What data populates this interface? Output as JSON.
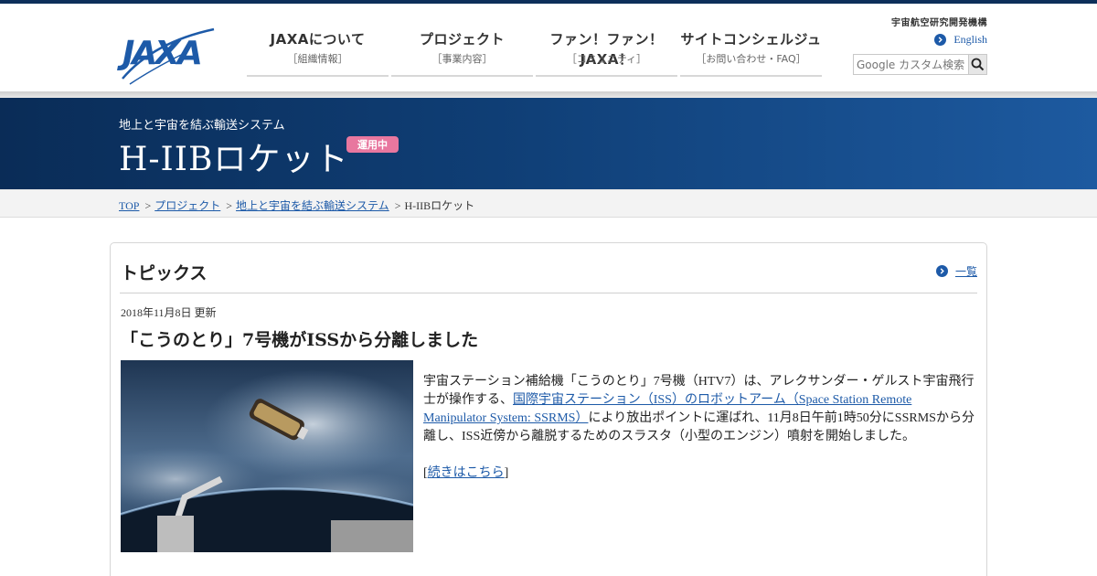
{
  "header": {
    "logo_text": "JAXA",
    "org_name": "宇宙航空研究開発機構",
    "english_label": "English",
    "search_placeholder": "Google カスタム検索",
    "nav": [
      {
        "main": "JAXAについて",
        "sub": "［組織情報］"
      },
      {
        "main": "プロジェクト",
        "sub": "［事業内容］"
      },
      {
        "main": "ファン！ファン！JAXA！",
        "sub": "［コミュニティ］"
      },
      {
        "main": "サイトコンシェルジュ",
        "sub": "［お問い合わせ・FAQ］"
      }
    ]
  },
  "hero": {
    "subtitle": "地上と宇宙を結ぶ輸送システム",
    "title": "H-IIBロケット",
    "badge": "運用中"
  },
  "breadcrumb": {
    "items": [
      "TOP",
      "プロジェクト",
      "地上と宇宙を結ぶ輸送システム"
    ],
    "current": "H-IIBロケット",
    "separator": ">"
  },
  "topics": {
    "title": "トピックス",
    "list_link": "一覧",
    "date": "2018年11月8日 更新",
    "headline": "「こうのとり」7号機がISSから分離しました",
    "text_before": "宇宙ステーション補給機「こうのとり」7号機（HTV7）は、アレクサンダー・ゲルスト宇宙飛行士が操作する、",
    "text_link": "国際宇宙ステーション（ISS）のロボットアーム（Space Station Remote Manipulator System: SSRMS）",
    "text_after": "により放出ポイントに運ばれ、11月8日午前1時50分にSSRMSから分離し、ISS近傍から離脱するためのスラスタ（小型のエンジン）噴射を開始しました。",
    "more_prefix": "[",
    "more_label": "続きはこちら",
    "more_suffix": "]"
  },
  "colors": {
    "brand_navy": "#0a2c57",
    "link_blue": "#1d5aa8",
    "badge_pink": "#e8779f"
  },
  "icons": [
    "jaxa-logo",
    "arrow-right-circle-icon",
    "search-icon"
  ]
}
